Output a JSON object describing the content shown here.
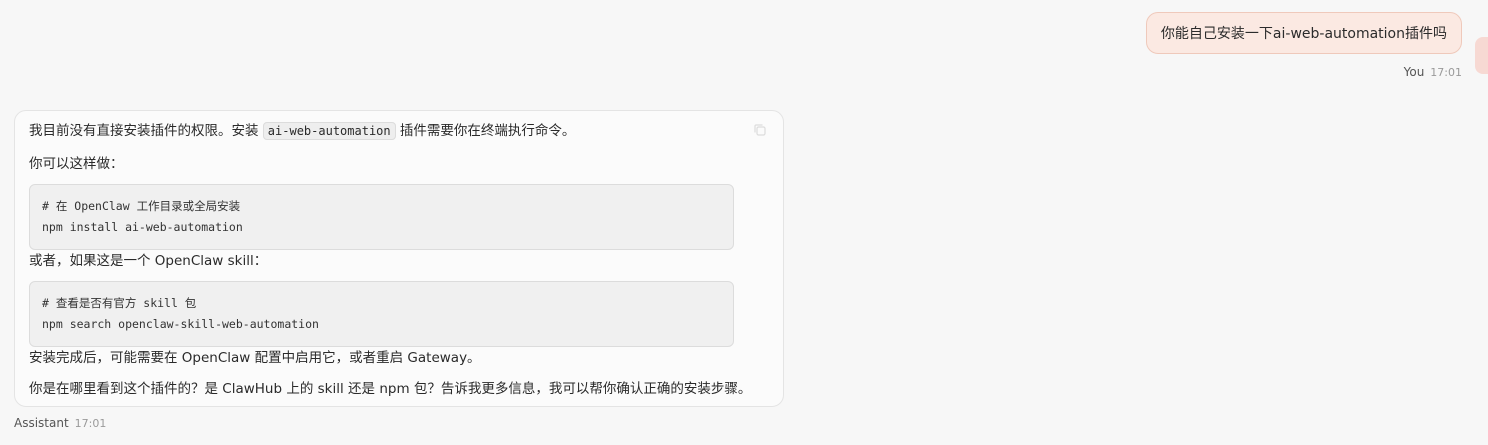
{
  "user_message": {
    "text": "你能自己安装一下ai-web-automation插件吗",
    "sender": "You",
    "time": "17:01"
  },
  "assistant_message": {
    "sender": "Assistant",
    "time": "17:01",
    "para1_before": "我目前没有直接安装插件的权限。安装 ",
    "para1_code": "ai-web-automation",
    "para1_after": " 插件需要你在终端执行命令。",
    "para2": "你可以这样做：",
    "code1_line1": "# 在 OpenClaw 工作目录或全局安装",
    "code1_line2": "npm install ai-web-automation",
    "para3": "或者，如果这是一个 OpenClaw skill：",
    "code2_line1": "# 查看是否有官方 skill 包",
    "code2_line2": "npm search openclaw-skill-web-automation",
    "para4": "安装完成后，可能需要在 OpenClaw 配置中启用它，或者重启 Gateway。",
    "para5": "你是在哪里看到这个插件的？是 ClawHub 上的 skill 还是 npm 包？告诉我更多信息，我可以帮你确认正确的安装步骤。"
  },
  "icons": {
    "copy": "copy-icon"
  },
  "colors": {
    "user_bubble_bg": "#fbe9e2",
    "user_bubble_border": "#efc9bb",
    "page_bg": "#f7f7f7"
  }
}
